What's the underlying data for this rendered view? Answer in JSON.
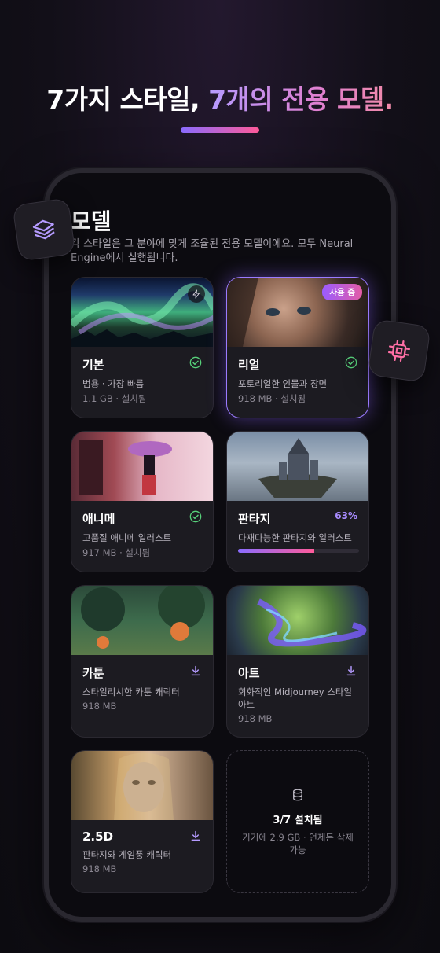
{
  "header": {
    "headline_part1": "7가지 스타일, ",
    "headline_part2": "7개의 전용 모델."
  },
  "screen": {
    "title": "모델",
    "subtitle": "각 스타일은 그 분야에 맞게 조율된 전용 모델이에요. 모두 Neural Engine에서 실행됩니다."
  },
  "models": [
    {
      "name": "기본",
      "desc": "범용 · 가장 빠름",
      "meta": "1.1 GB · 설치됨",
      "status": "installed",
      "icon": "bolt-icon"
    },
    {
      "name": "리얼",
      "desc": "포토리얼한 인물과 장면",
      "meta": "918 MB · 설치됨",
      "status": "installed",
      "badge": "사용 중"
    },
    {
      "name": "애니메",
      "desc": "고품질 애니메 일러스트",
      "meta": "917 MB · 설치됨",
      "status": "installed"
    },
    {
      "name": "판타지",
      "desc": "다재다능한 판타지와 일러스트",
      "status": "downloading",
      "progress_label": "63%",
      "progress": 0.63
    },
    {
      "name": "카툰",
      "desc": "스타일리시한 카툰 캐릭터",
      "meta": "918 MB",
      "status": "download"
    },
    {
      "name": "아트",
      "desc": "회화적인 Midjourney 스타일 아트",
      "meta": "918 MB",
      "status": "download"
    },
    {
      "name": "2.5D",
      "desc": "판타지와 게임풍 캐릭터",
      "meta": "918 MB",
      "status": "download"
    }
  ],
  "summary": {
    "count": "3/7 설치됨",
    "note": "기기에 2.9 GB · 언제든 삭제 가능"
  },
  "colors": {
    "accent_purple": "#a88bff",
    "accent_pink": "#ff5b9a",
    "check_green": "#57d07a",
    "download_purple": "#b59bff"
  }
}
